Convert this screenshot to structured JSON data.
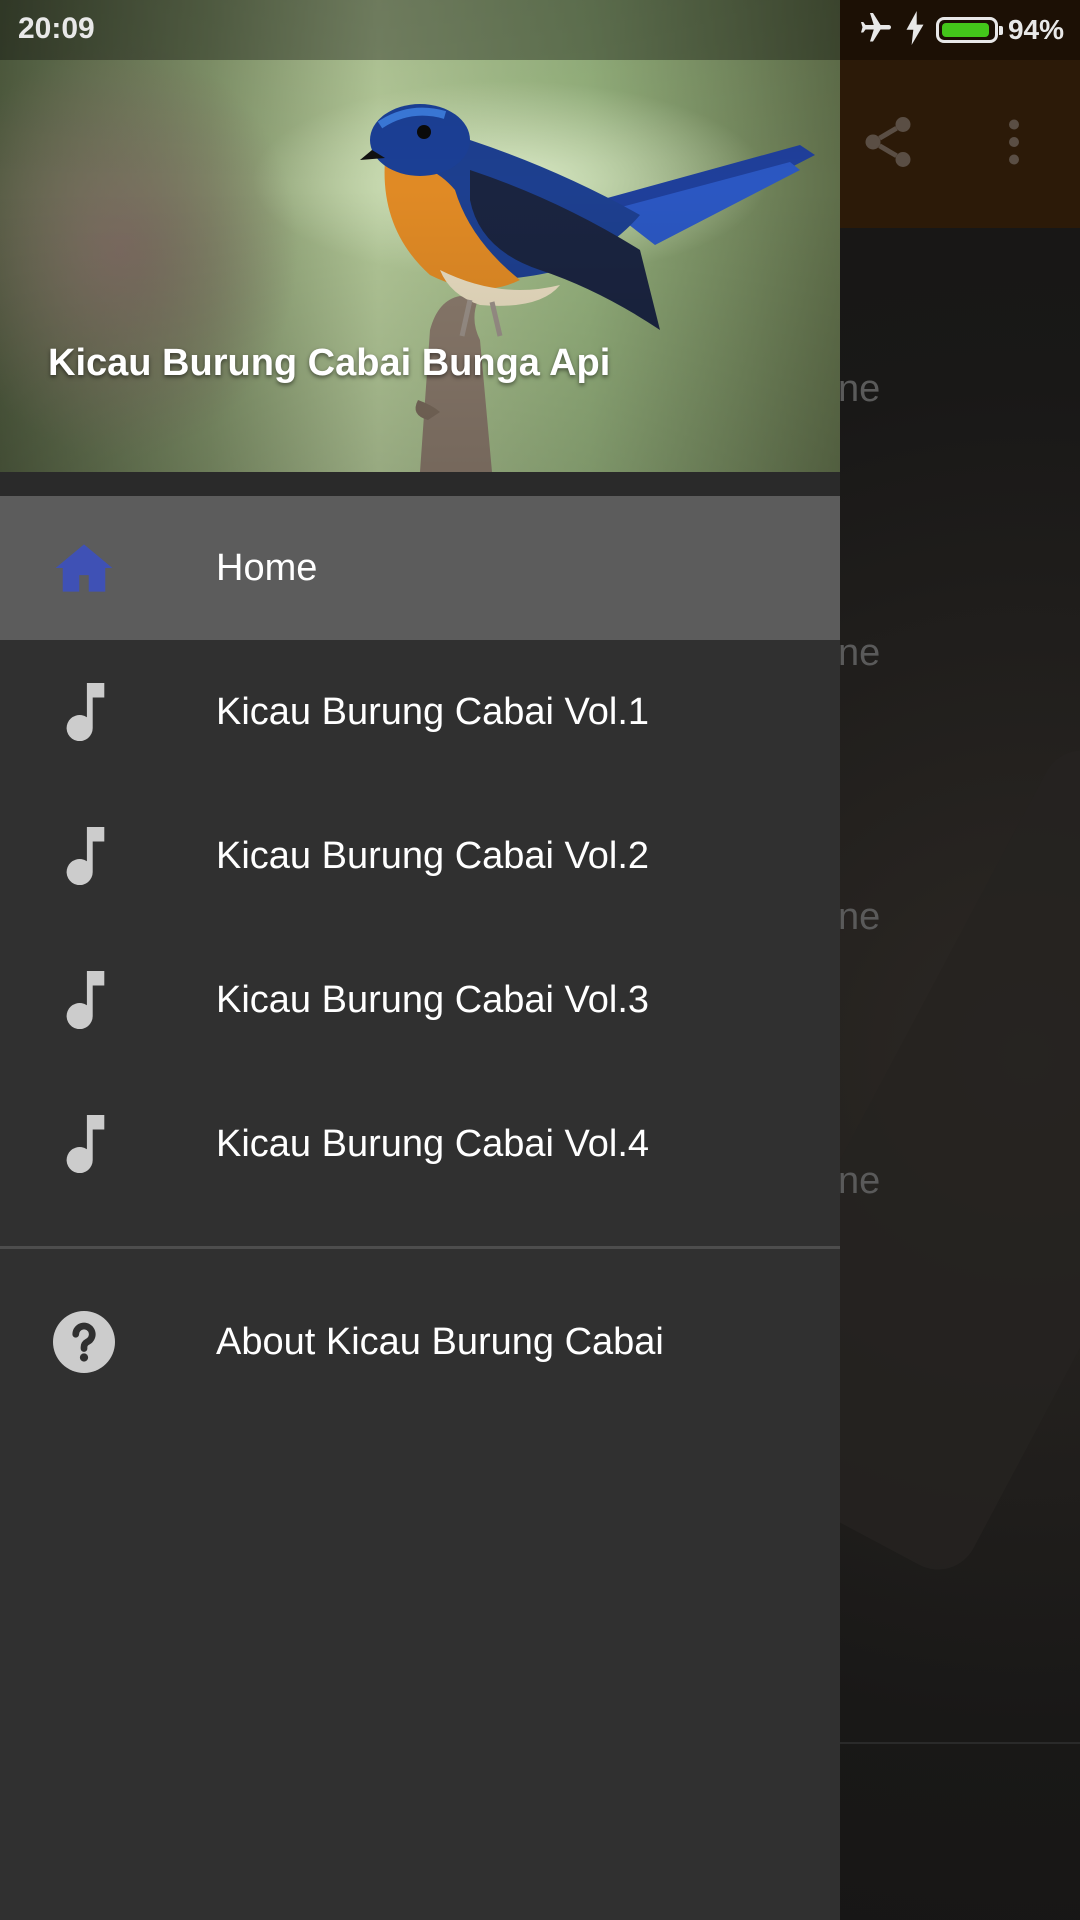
{
  "status_bar": {
    "time": "20:09",
    "battery_percent": "94%",
    "battery_level": 0.94,
    "icons": [
      "airplane-mode-icon",
      "charging-icon",
      "battery-icon"
    ]
  },
  "drawer": {
    "header_title": "Kicau Burung Cabai Bunga Api",
    "items": [
      {
        "label": "Home",
        "icon": "home-icon",
        "selected": true
      },
      {
        "label": "Kicau Burung Cabai Vol.1",
        "icon": "music-note-icon"
      },
      {
        "label": "Kicau Burung Cabai Vol.2",
        "icon": "music-note-icon"
      },
      {
        "label": "Kicau Burung Cabai Vol.3",
        "icon": "music-note-icon"
      },
      {
        "label": "Kicau Burung Cabai Vol.4",
        "icon": "music-note-icon"
      }
    ],
    "about": {
      "label": "About Kicau Burung Cabai",
      "icon": "help-circle-icon"
    }
  },
  "background_app": {
    "toolbar_icons": [
      "share-icon",
      "more-vert-icon"
    ],
    "row_text_fragments": [
      "ne",
      "ne",
      "ne",
      "ne"
    ]
  },
  "colors": {
    "home_icon": "#3f51b5",
    "drawer_bg": "#303030",
    "selected_row": "#5c5c5c",
    "toolbar_bg": "#2c1a08",
    "battery_fill": "#43c61a"
  }
}
